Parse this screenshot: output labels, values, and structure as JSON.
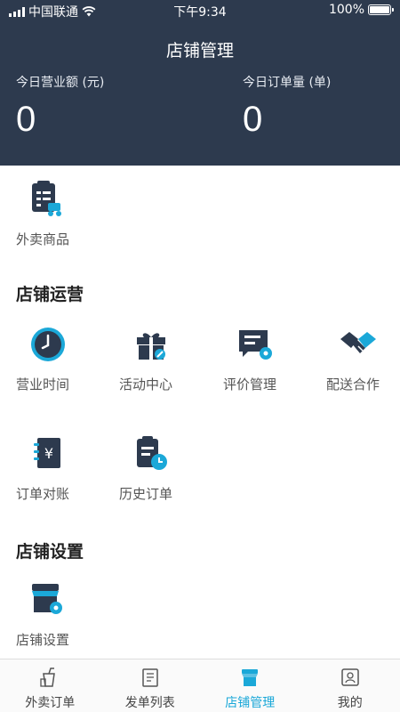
{
  "status": {
    "carrier": "中国联通",
    "time": "下午9:34",
    "battery": "100%"
  },
  "header": {
    "title": "店铺管理",
    "revenue_label": "今日营业额 (元)",
    "revenue_value": "0",
    "orders_label": "今日订单量 (单)",
    "orders_value": "0"
  },
  "top": {
    "takeout_goods": "外卖商品"
  },
  "operations": {
    "title": "店铺运营",
    "items": [
      "营业时间",
      "活动中心",
      "评价管理",
      "配送合作",
      "订单对账",
      "历史订单"
    ]
  },
  "settings": {
    "title": "店铺设置",
    "items": [
      "店铺设置"
    ]
  },
  "tabs": [
    "外卖订单",
    "发单列表",
    "店铺管理",
    "我的"
  ],
  "colors": {
    "header_bg": "#2d3a4e",
    "accent": "#1ba8d8",
    "icon_dark": "#2d3a4e"
  }
}
